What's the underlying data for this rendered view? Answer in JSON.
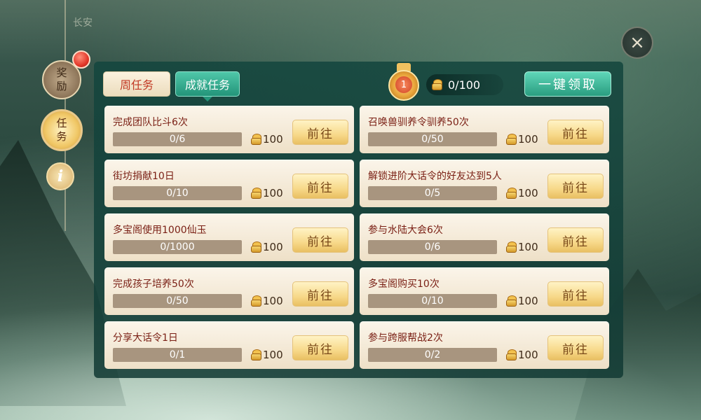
{
  "map": {
    "location_label": "长安"
  },
  "side_nav": {
    "reward_label": "奖励",
    "task_label": "任务",
    "info_label": "i"
  },
  "tabs": {
    "weekly": "周任务",
    "achievement": "成就任务"
  },
  "header": {
    "medal_level": "1",
    "points": "0/100",
    "claim_all": "一键领取"
  },
  "close_icon": "×",
  "tasks_left": [
    {
      "title": "完成团队比斗6次",
      "progress": "0/6",
      "reward": "100",
      "button": "前往"
    },
    {
      "title": "街坊捐献10日",
      "progress": "0/10",
      "reward": "100",
      "button": "前往"
    },
    {
      "title": "多宝阁使用1000仙玉",
      "progress": "0/1000",
      "reward": "100",
      "button": "前往"
    },
    {
      "title": "完成孩子培养50次",
      "progress": "0/50",
      "reward": "100",
      "button": "前往"
    },
    {
      "title": "分享大话令1日",
      "progress": "0/1",
      "reward": "100",
      "button": "前往"
    }
  ],
  "tasks_right": [
    {
      "title": "召唤兽驯养令驯养50次",
      "progress": "0/50",
      "reward": "100",
      "button": "前往"
    },
    {
      "title": "解锁进阶大话令的好友达到5人",
      "progress": "0/5",
      "reward": "100",
      "button": "前往"
    },
    {
      "title": "参与水陆大会6次",
      "progress": "0/6",
      "reward": "100",
      "button": "前往"
    },
    {
      "title": "多宝阁购买10次",
      "progress": "0/10",
      "reward": "100",
      "button": "前往"
    },
    {
      "title": "参与跨服帮战2次",
      "progress": "0/2",
      "reward": "100",
      "button": "前往"
    }
  ]
}
